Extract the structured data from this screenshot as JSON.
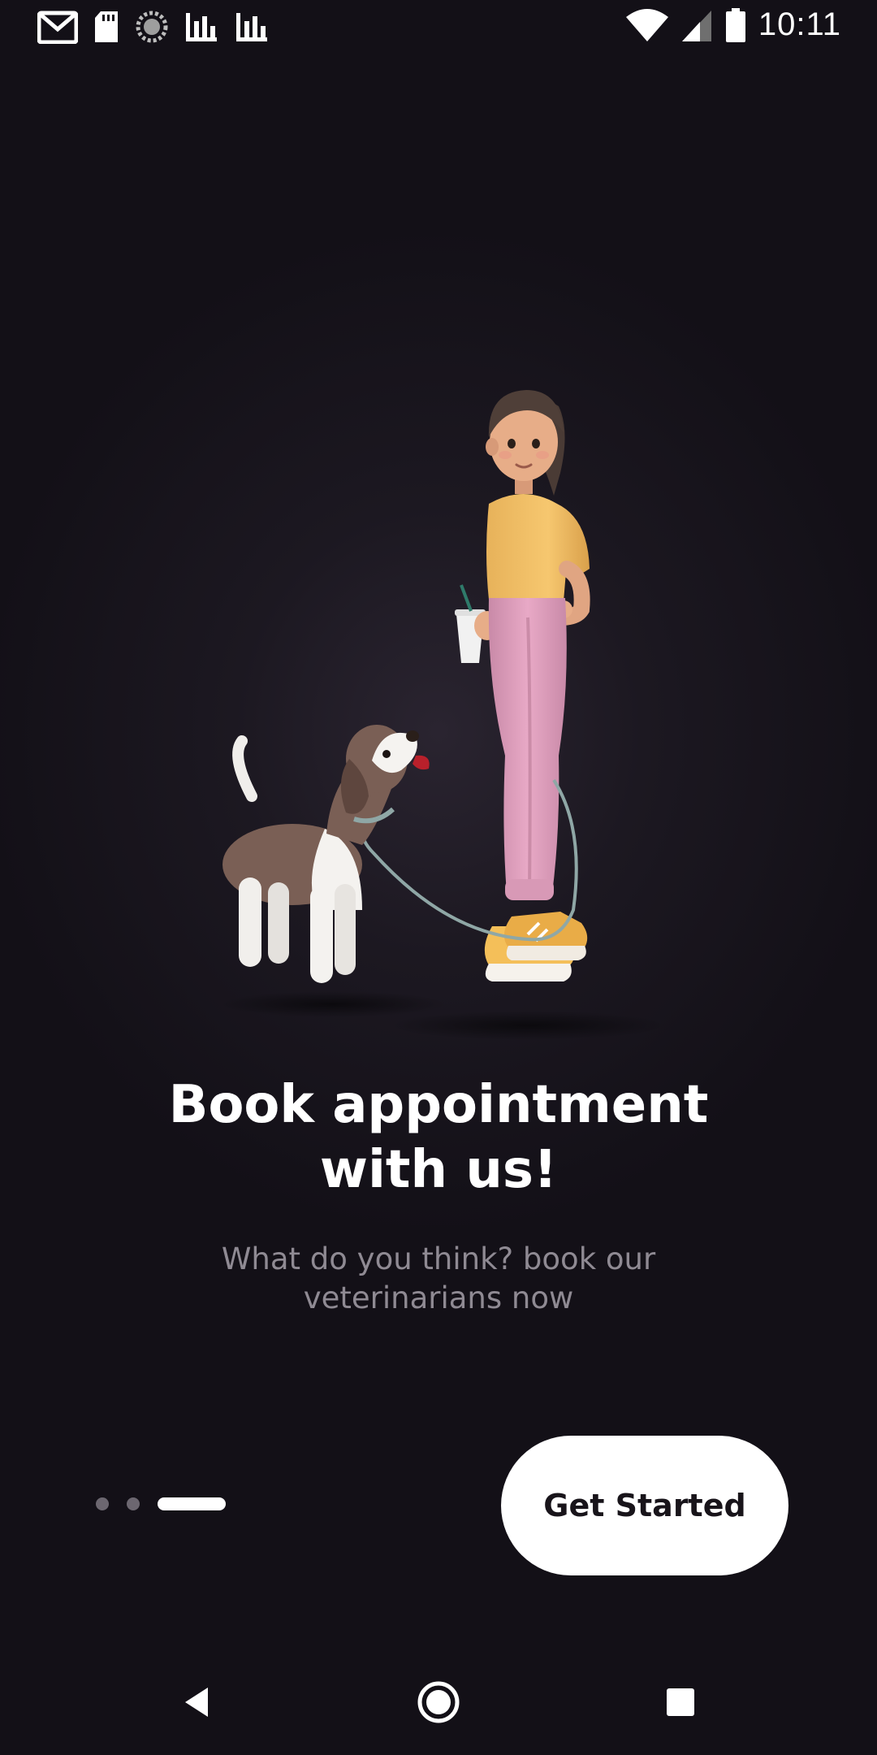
{
  "status_bar": {
    "time": "10:11",
    "left_icons": [
      "gmail-icon",
      "sd-card-icon",
      "sync-icon",
      "signal-chart-icon",
      "signal-chart-icon"
    ],
    "right_icons": [
      "wifi-icon",
      "cell-signal-icon",
      "battery-icon"
    ]
  },
  "onboarding": {
    "illustration": "woman-walking-dog-illustration",
    "title_line1": "Book appointment",
    "title_line2": "with us!",
    "subtitle_line1": "What do you think? book our",
    "subtitle_line2": "veterinarians now",
    "pager": {
      "total": 3,
      "current": 3
    },
    "cta_label": "Get Started"
  },
  "navigation_bar": {
    "buttons": [
      "back-icon",
      "home-icon",
      "recents-icon"
    ]
  },
  "colors": {
    "background": "#131017",
    "primary_text": "#ffffff",
    "secondary_text": "#8f8a93",
    "button_bg": "#ffffff",
    "button_text": "#18141a",
    "dot_inactive": "#6c6770"
  }
}
